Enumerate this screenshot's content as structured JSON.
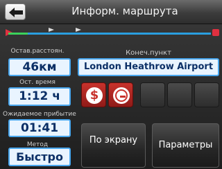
{
  "header": {
    "title": "Информ. маршрута",
    "back_icon": "back-arrow-icon"
  },
  "route": {
    "remaining_distance_label": "Остав.расстоян.",
    "remaining_distance_value": "46км",
    "remaining_time_label": "Ост. время",
    "remaining_time_value": "1:12 ч",
    "arrival_label": "Ожидаемое прибытие",
    "arrival_value": "01:41",
    "method_label": "Метод",
    "method_value": "Быстро",
    "destination_label": "Конеч.пункт",
    "destination_value": "London Heathrow Airport"
  },
  "avoid_icons": [
    "toll-road-icon",
    "no-entry-icon"
  ],
  "buttons": {
    "on_screen": "По экрану",
    "params": "Параметры"
  },
  "colors": {
    "accent": "#49a7ee",
    "avoid_red": "#c8322c",
    "track_green": "#3bd15b",
    "track_blue": "#2a9fe0"
  }
}
